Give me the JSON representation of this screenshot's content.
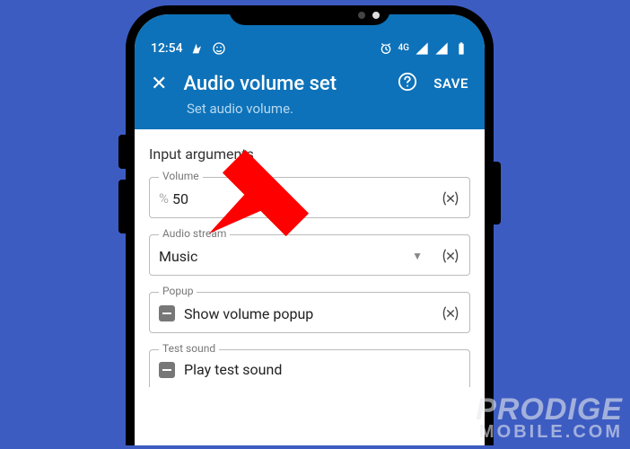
{
  "statusbar": {
    "time": "12:54",
    "network": "4G"
  },
  "header": {
    "title": "Audio volume set",
    "subtitle": "Set audio volume.",
    "save_label": "SAVE"
  },
  "content": {
    "section_title": "Input arguments",
    "fields": {
      "volume": {
        "label": "Volume",
        "value": "50"
      },
      "audiostream": {
        "label": "Audio stream",
        "value": "Music"
      },
      "popup": {
        "label": "Popup",
        "value": "Show volume popup"
      },
      "testsound": {
        "label": "Test sound",
        "value": "Play test sound"
      }
    }
  },
  "watermark": {
    "line1": "PRODIGE",
    "line2": "MOBILE.COM"
  }
}
